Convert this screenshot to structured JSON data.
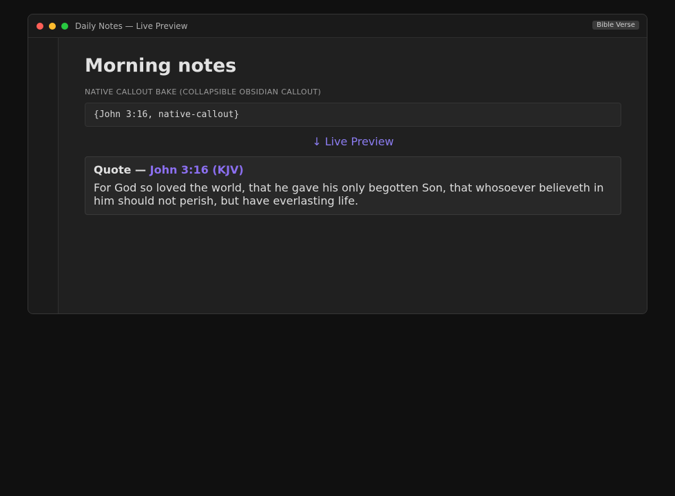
{
  "window": {
    "title": "Daily Notes — Live Preview",
    "plugin_badge": "Bible Verse"
  },
  "note": {
    "title": "Morning notes",
    "section_label": "NATIVE CALLOUT BAKE (COLLAPSIBLE OBSIDIAN CALLOUT)",
    "code": "{John 3:16, native-callout}",
    "preview_label": "↓ Live Preview"
  },
  "callout": {
    "type_label": "Quote",
    "separator": " — ",
    "reference": "John 3:16 (KJV)",
    "text": "For God so loved the world, that he gave his only begotten Son, that whosoever believeth in him should not perish, but have everlasting life."
  },
  "colors": {
    "accent": "#8b6ff0",
    "background": "#101010",
    "window": "#1e1e1e"
  }
}
